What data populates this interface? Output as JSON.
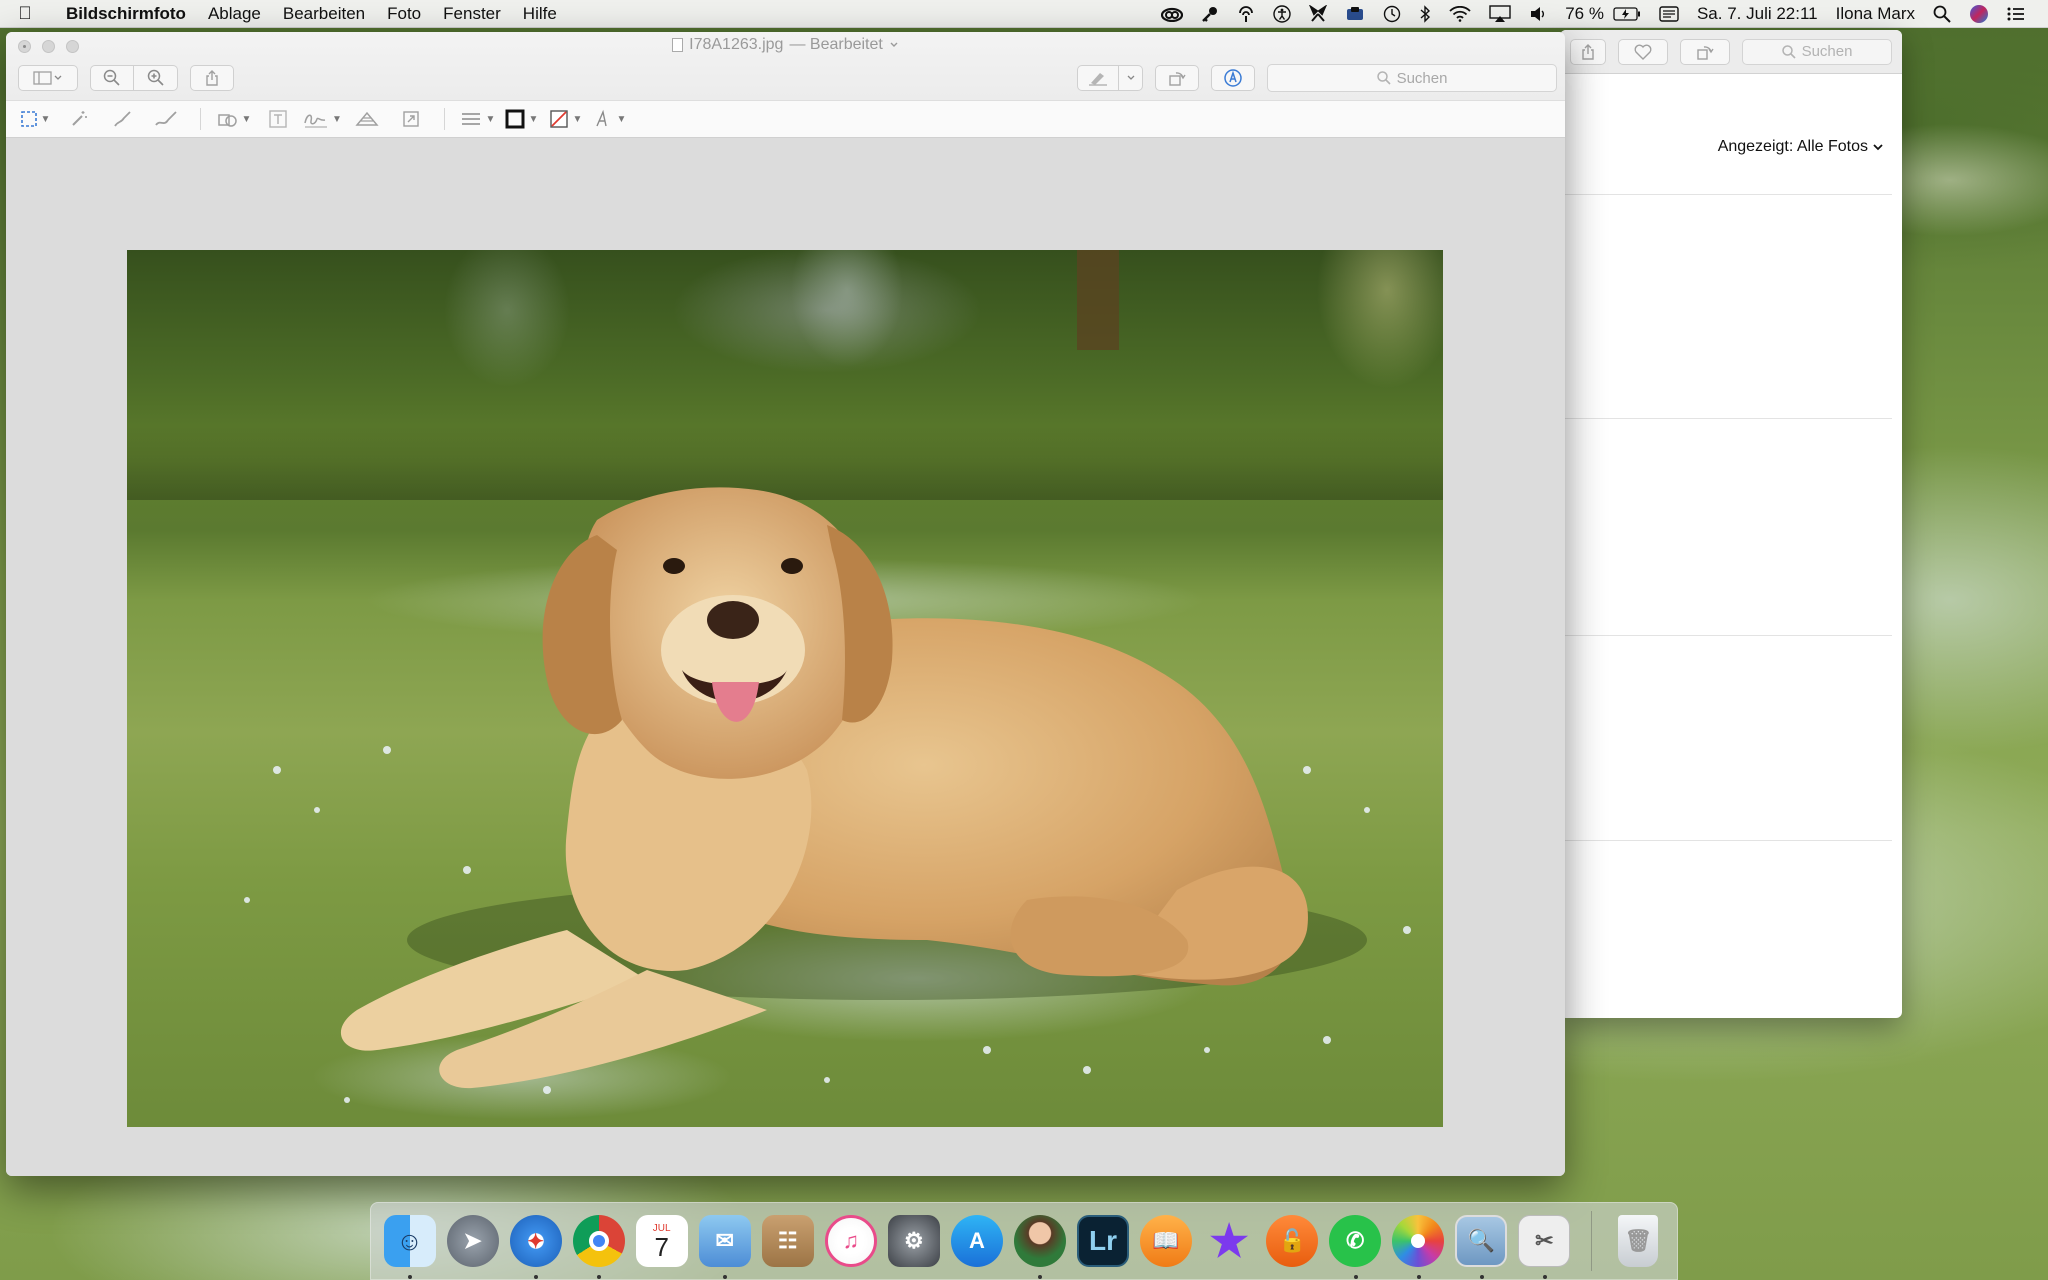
{
  "menubar": {
    "app_name": "Bildschirmfoto",
    "menus": [
      "Ablage",
      "Bearbeiten",
      "Foto",
      "Fenster",
      "Hilfe"
    ],
    "battery": "76 %",
    "datetime": "Sa. 7. Juli  22:11",
    "user": "Ilona Marx"
  },
  "preview": {
    "filename": "I78A1263.jpg",
    "status": "— Bearbeitet",
    "search_placeholder": "Suchen"
  },
  "photos_window": {
    "search_placeholder": "Suchen",
    "filter_label": "Angezeigt: Alle Fotos"
  },
  "dock": {
    "apps": [
      {
        "name": "Finder",
        "running": true
      },
      {
        "name": "Launchpad",
        "running": false
      },
      {
        "name": "Safari",
        "running": true
      },
      {
        "name": "Chrome",
        "running": true
      },
      {
        "name": "Kalender",
        "running": false,
        "month": "JUL",
        "day": "7"
      },
      {
        "name": "Mail",
        "running": true
      },
      {
        "name": "Kontakte",
        "running": false
      },
      {
        "name": "iTunes",
        "running": false
      },
      {
        "name": "Systemeinstellungen",
        "running": false
      },
      {
        "name": "App Store",
        "running": false
      },
      {
        "name": "Avatar App",
        "running": true
      },
      {
        "name": "Lightroom",
        "running": false,
        "label": "Lr"
      },
      {
        "name": "iBooks",
        "running": false
      },
      {
        "name": "iMovie",
        "running": false
      },
      {
        "name": "VPN",
        "running": false
      },
      {
        "name": "WhatsApp",
        "running": true
      },
      {
        "name": "Fotos",
        "running": true
      },
      {
        "name": "Vorschau",
        "running": true
      },
      {
        "name": "Bildschirmfoto",
        "running": true
      },
      {
        "name": "Papierkorb",
        "running": false
      }
    ]
  },
  "colors": {
    "markup_rect": "#3a7bd5",
    "border_color_swatch": "#111111",
    "fill_color_swatch": "#e03a2f"
  }
}
